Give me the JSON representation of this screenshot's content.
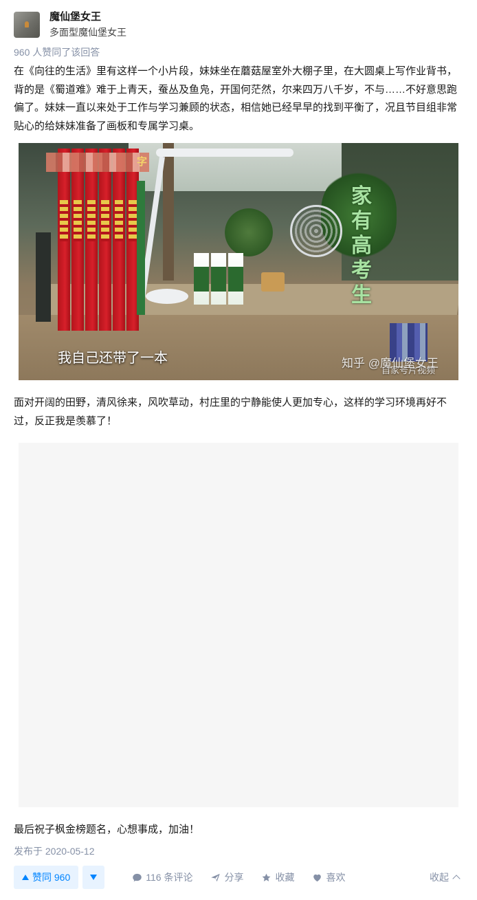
{
  "author": {
    "name": "魔仙堡女王",
    "headline": "多面型魔仙堡女王"
  },
  "vote_summary": "960 人赞同了该回答",
  "paragraphs": [
    "在《向往的生活》里有这样一个小片段，妹妹坐在蘑菇屋室外大棚子里，在大圆桌上写作业背书，背的是《蜀道难》难于上青天，蚕丛及鱼凫，开国何茫然，尔来四万八千岁，不与……不好意思跑偏了。妹妹一直以来处于工作与学习兼顾的状态，相信她已经早早的找到平衡了，况且节目组非常贴心的给妹妹准备了画板和专属学习桌。",
    "面对开阔的田野，清风徐来，风吹草动，村庄里的宁静能使人更加专心，这样的学习环境再好不过，反正我是羡慕了！",
    "最后祝子枫金榜题名，心想事成，加油！"
  ],
  "figure": {
    "side_caption": "家有高考生",
    "subtitle": "我自己还带了一本",
    "watermark": "知乎 @魔仙堡女王",
    "source": "自家号片视频",
    "logo_fragment": "字",
    "colors": {
      "book_red": "#d7202a",
      "caption_green": "#a8e2a2"
    }
  },
  "publish_date": "发布于 2020-05-12",
  "actions": {
    "vote_up_label": "赞同 960",
    "comments_label": "116 条评论",
    "share_label": "分享",
    "favorite_label": "收藏",
    "like_label": "喜欢",
    "collapse_label": "收起"
  },
  "icons": {
    "vote_up": "triangle-up-icon",
    "vote_down": "triangle-down-icon",
    "comment": "comment-bubble-icon",
    "share": "paper-plane-icon",
    "favorite": "star-icon",
    "like": "heart-icon",
    "collapse": "chevron-up-icon"
  },
  "theme": {
    "accent": "#0084ff",
    "accent_bg": "#e8f3ff",
    "muted_text": "#8590a6",
    "placeholder_bg": "#f6f6f6"
  }
}
